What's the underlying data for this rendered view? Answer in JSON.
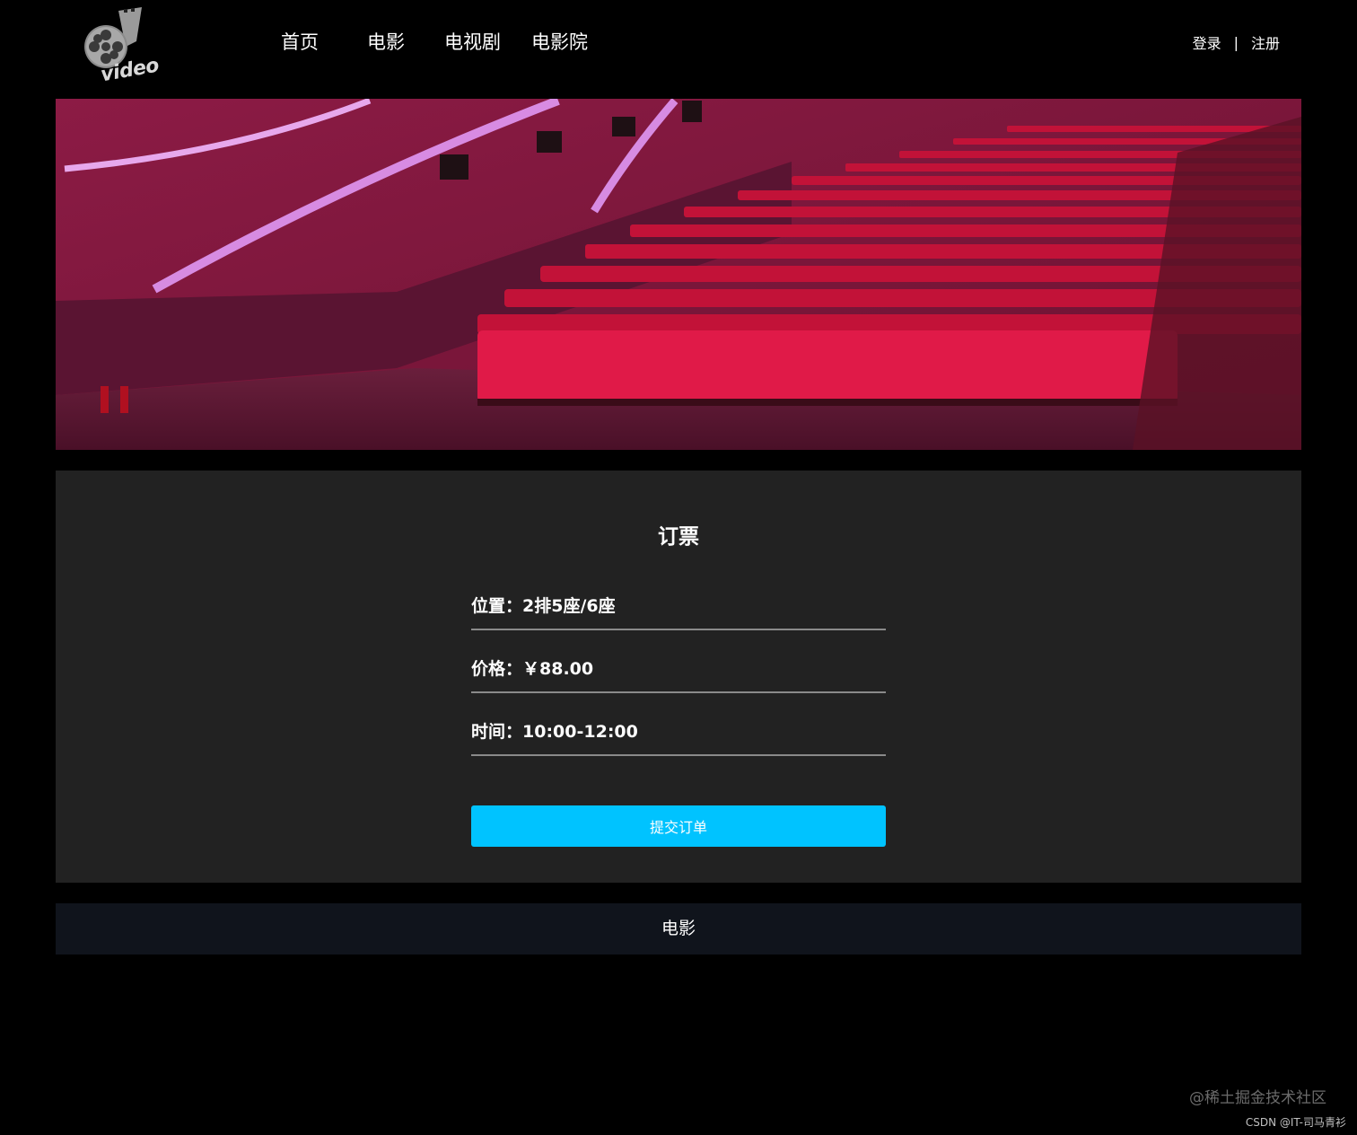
{
  "header": {
    "logo_text": "video",
    "nav": [
      "首页",
      "电影",
      "电视剧",
      "电影院"
    ],
    "auth": {
      "login": "登录",
      "separator": "|",
      "register": "注册"
    }
  },
  "booking": {
    "title": "订票",
    "seat": {
      "label": "位置：",
      "value": "2排5座/6座"
    },
    "price": {
      "label": "价格：",
      "value": "￥88.00"
    },
    "time": {
      "label": "时间：",
      "value": "10:00-12:00"
    },
    "submit_label": "提交订单"
  },
  "footer": {
    "text": "电影"
  },
  "watermarks": {
    "primary": "@稀土掘金技术社区",
    "secondary": "CSDN @IT-司马青衫"
  },
  "colors": {
    "accent": "#00c3ff",
    "card_bg": "#222222",
    "footer_bg": "#10141c",
    "page_bg": "#000000"
  }
}
